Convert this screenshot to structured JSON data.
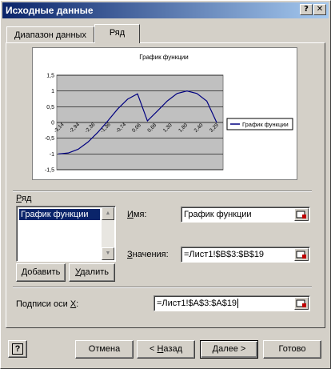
{
  "window": {
    "title": "Исходные данные",
    "help_glyph": "?",
    "close_glyph": "✕"
  },
  "tabs": [
    {
      "label": "Диапазон данных",
      "active": false
    },
    {
      "label": "Ряд",
      "active": true
    }
  ],
  "chart_data": {
    "type": "line",
    "title": "График функции",
    "series": [
      {
        "name": "График функции",
        "color": "#000080",
        "x": [
          -3.14,
          -2.75,
          -2.36,
          -1.96,
          -1.57,
          -1.18,
          -0.79,
          -0.39,
          0.0,
          0.39,
          0.79,
          1.18,
          1.57,
          1.96,
          2.36,
          2.75,
          3.14
        ],
        "y": [
          -1.0,
          -0.97,
          -0.85,
          -0.62,
          -0.31,
          0.05,
          0.43,
          0.74,
          0.91,
          0.05,
          0.36,
          0.68,
          0.92,
          1.0,
          0.92,
          0.68,
          0.0
        ]
      }
    ],
    "x_tick_labels": [
      "-3,14",
      "-2,94",
      "-2,36",
      "-1,36",
      "-0,74",
      "0,06",
      "0,68",
      "1,30",
      "1,80",
      "2,40",
      "3,29"
    ],
    "y_tick_labels": [
      "1,5",
      "1",
      "0,5",
      "0",
      "-0,5",
      "-1",
      "-1,5"
    ],
    "ylim": [
      -1.5,
      1.5
    ],
    "grid": true,
    "plot_background": "#c0c0c0",
    "legend_position": "right"
  },
  "series_section": {
    "label": "Ряд",
    "label_underline": "Р",
    "label_rest": "яд",
    "list_items": [
      "График функции"
    ],
    "add_button": "Добавить",
    "add_underline": "Д",
    "add_rest": "обавить",
    "remove_button": "Удалить",
    "remove_underline": "У",
    "remove_rest": "далить",
    "name_label_underline": "И",
    "name_label_rest": "мя:",
    "name_value": "График функции",
    "values_label_underline": "З",
    "values_label_rest": "начения:",
    "values_value": "=Лист1!$B$3:$B$19"
  },
  "x_axis_section": {
    "label_pre": "Подписи оси ",
    "label_underline": "X",
    "label_rest": ":",
    "value": "=Лист1!$A$3:$A$19"
  },
  "footer": {
    "help_glyph": "?",
    "cancel": "Отмена",
    "back_pre": "< ",
    "back_underline": "Н",
    "back_rest": "азад",
    "next_pre": "",
    "next_underline": "Д",
    "next_rest": "алее >",
    "finish": "Готово"
  }
}
